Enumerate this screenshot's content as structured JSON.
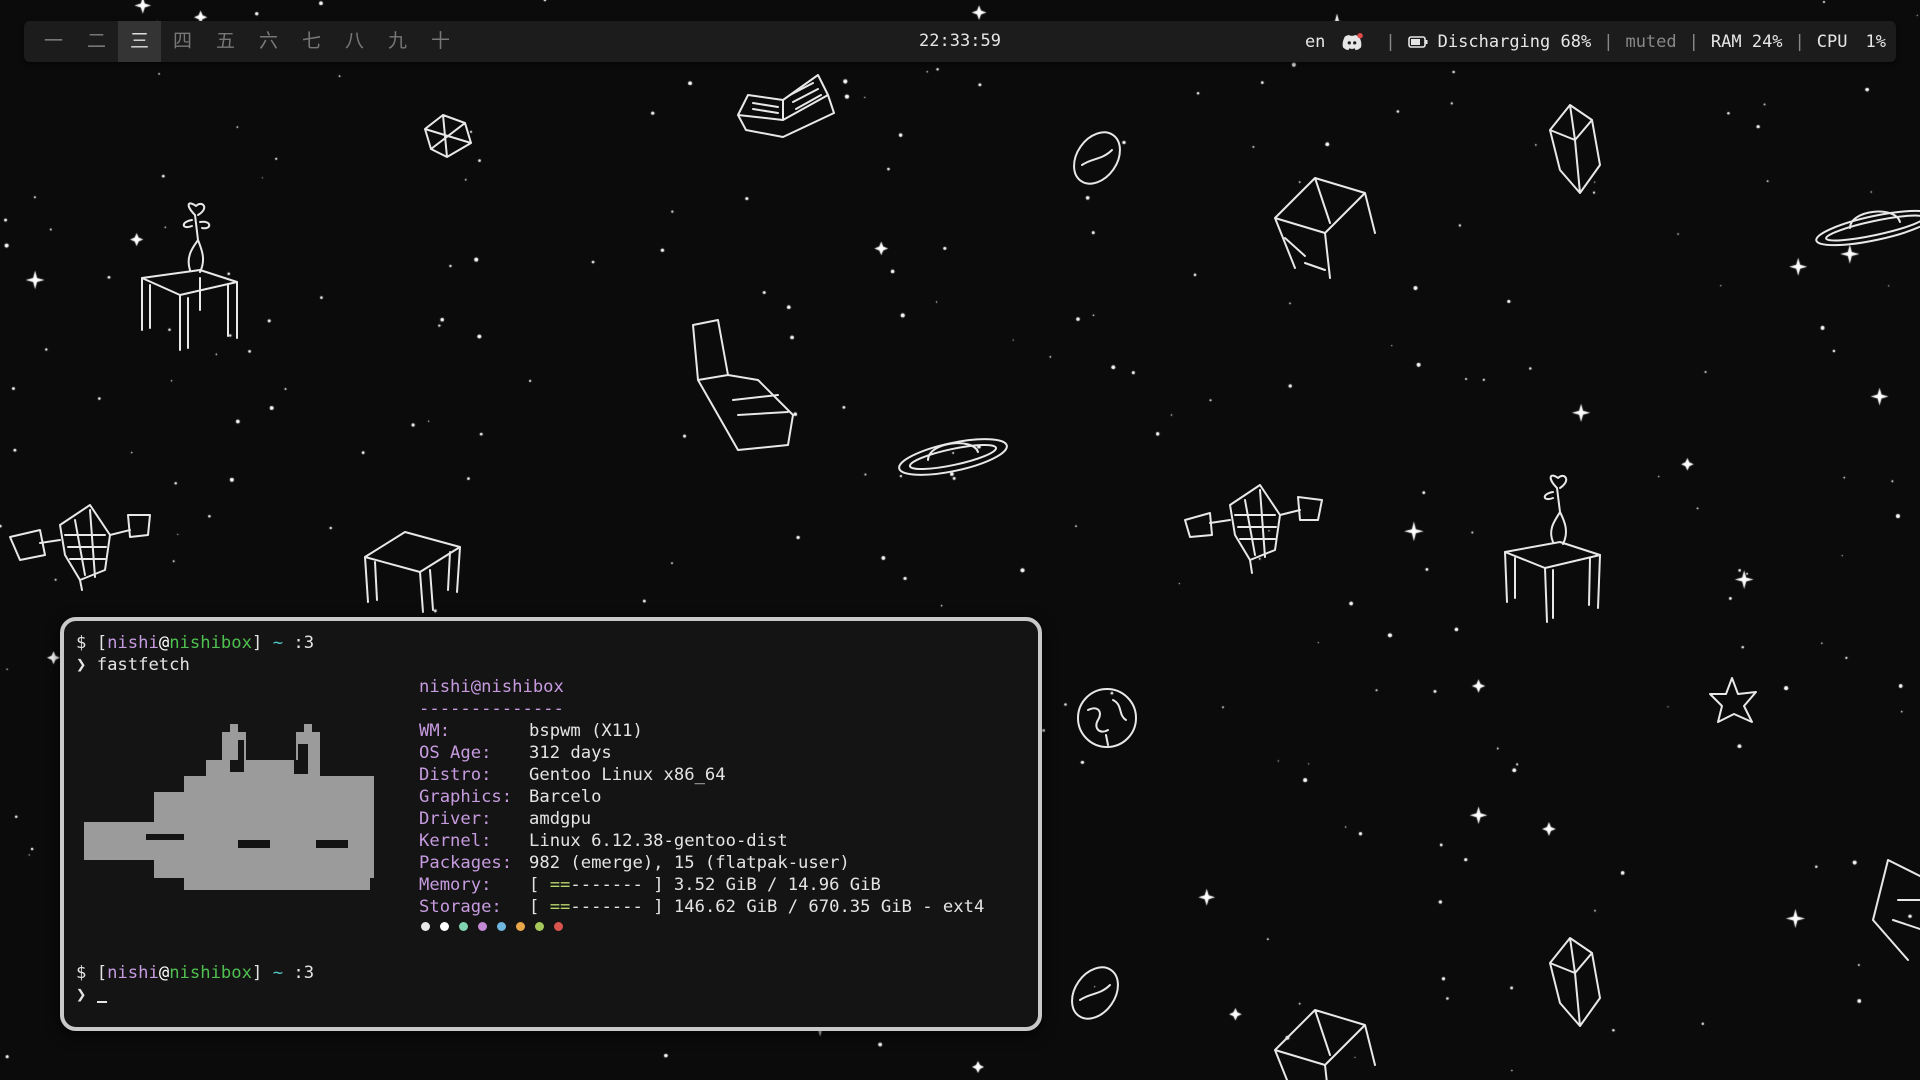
{
  "workspaces": [
    "一",
    "二",
    "三",
    "四",
    "五",
    "六",
    "七",
    "八",
    "九",
    "十"
  ],
  "active_workspace": 2,
  "clock": "22:33:59",
  "status": {
    "lang": "en",
    "battery": "Discharging 68%",
    "volume": "muted",
    "ram": "RAM 24%",
    "cpu_label": "CPU",
    "cpu_value": "1%"
  },
  "terminal": {
    "prompt1": {
      "dollar": "$",
      "lb": "[",
      "user": "nishi",
      "at": "@",
      "host": "nishibox",
      "rb": "]",
      "dir": "~",
      "tail": ":3"
    },
    "arrow": "❯",
    "command": "fastfetch",
    "header": "nishi@nishibox",
    "divider": "--------------",
    "info": [
      {
        "key": "WM:",
        "value": "bspwm (X11)"
      },
      {
        "key": "OS Age:",
        "value": "312 days"
      },
      {
        "key": "Distro:",
        "value": "Gentoo Linux x86_64"
      },
      {
        "key": "Graphics:",
        "value": "Barcelo"
      },
      {
        "key": "Driver:",
        "value": "amdgpu"
      },
      {
        "key": "Kernel:",
        "value": "Linux 6.12.38-gentoo-dist"
      },
      {
        "key": "Packages:",
        "value": "982 (emerge), 15 (flatpak-user)"
      }
    ],
    "memory": {
      "key": "Memory:",
      "open": "[ ",
      "used_bar": "==",
      "free_bar": "-------",
      "close": " ]",
      "value": " 3.52 GiB / 14.96 GiB"
    },
    "storage": {
      "key": "Storage:",
      "open": "[ ",
      "used_bar": "==",
      "free_bar": "-------",
      "close": " ]",
      "value": " 146.62 GiB / 670.35 GiB - ext4"
    },
    "palette": [
      "#e8e8e8",
      "#ffffff",
      "#7fd3b0",
      "#c48ad6",
      "#6fb6e0",
      "#e8a84a",
      "#a6c85a",
      "#d9534f"
    ],
    "prompt2": {
      "dollar": "$",
      "lb": "[",
      "user": "nishi",
      "at": "@",
      "host": "nishibox",
      "rb": "]",
      "dir": "~",
      "tail": ":3"
    }
  },
  "colors": {
    "accent_green": "#4fc04f",
    "accent_purple": "#c79be0",
    "bar_bg": "#1c1c1c"
  }
}
